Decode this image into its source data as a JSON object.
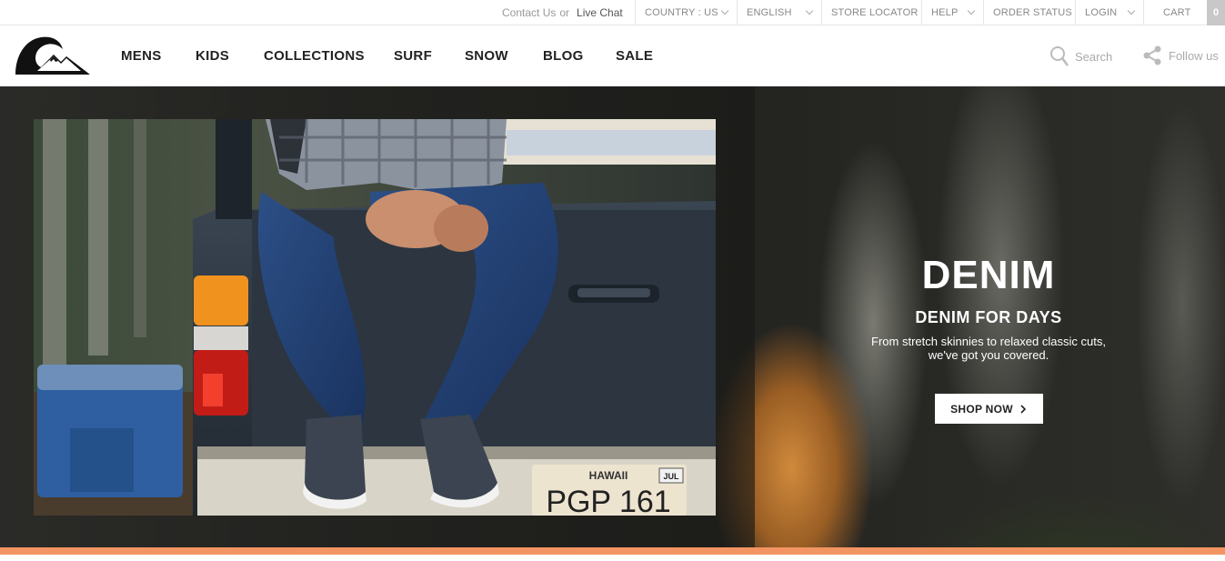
{
  "topbar": {
    "contact_text": "Contact Us",
    "or_text": "or",
    "live_chat": "Live Chat",
    "items": [
      {
        "label": "COUNTRY : US",
        "has_dropdown": true
      },
      {
        "label": "ENGLISH",
        "has_dropdown": true
      },
      {
        "label": "STORE LOCATOR",
        "has_dropdown": false
      },
      {
        "label": "HELP",
        "has_dropdown": true
      },
      {
        "label": "ORDER STATUS",
        "has_dropdown": false
      },
      {
        "label": "LOGIN",
        "has_dropdown": true
      },
      {
        "label": "CART",
        "has_dropdown": false
      }
    ],
    "cart_count": "0"
  },
  "nav": {
    "logo_icon": "quiksilver-wave-mountain-logo",
    "links": [
      "MENS",
      "KIDS",
      "COLLECTIONS",
      "SURF",
      "SNOW",
      "BLOG",
      "SALE"
    ],
    "search_label": "Search",
    "search_icon": "magnifier-icon",
    "follow_label": "Follow us",
    "follow_icon": "share-icon"
  },
  "hero": {
    "title": "DENIM",
    "subtitle": "DENIM FOR DAYS",
    "description_line1": "From stretch skinnies to relaxed classic cuts,",
    "description_line2": "we've got you covered.",
    "cta_label": "SHOP NOW",
    "plate_state": "HAWAII",
    "plate_number": "PGP 161",
    "plate_sticker": "JUL"
  },
  "colors": {
    "accent_bar": "#f39463",
    "cart_badge": "#c8c8c8",
    "nav_text": "#222222"
  }
}
